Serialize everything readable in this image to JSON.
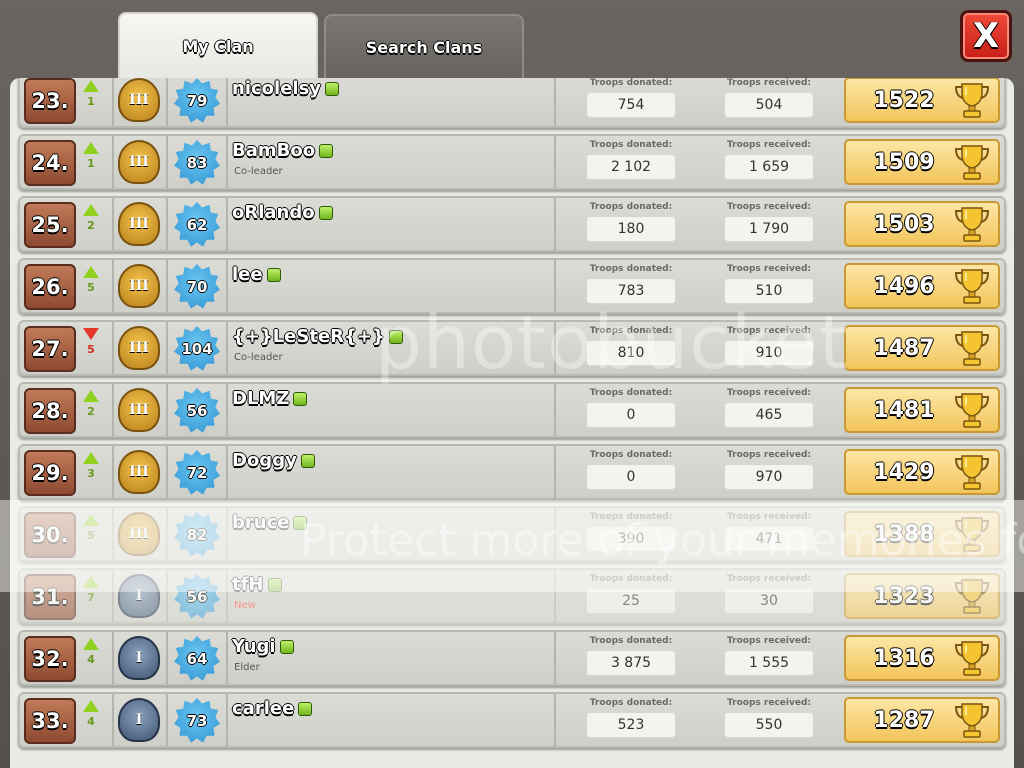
{
  "tabs": [
    {
      "label": "My Clan",
      "active": true
    },
    {
      "label": "Search Clans",
      "active": false
    }
  ],
  "close_label": "X",
  "stat_labels": {
    "donated": "Troops donated:",
    "received": "Troops received:"
  },
  "watermark": {
    "main": "photobucket",
    "sub": "Protect more of your memories for less!"
  },
  "members": [
    {
      "rank": "23.",
      "trend": "up",
      "delta": "1",
      "league": "gold",
      "league_label": "III",
      "level": "79",
      "name": "nicolelsy",
      "role": "",
      "donated": "754",
      "received": "504",
      "trophies": "1522"
    },
    {
      "rank": "24.",
      "trend": "up",
      "delta": "1",
      "league": "gold",
      "league_label": "III",
      "level": "83",
      "name": "BamBoo",
      "role": "Co-leader",
      "donated": "2 102",
      "received": "1 659",
      "trophies": "1509"
    },
    {
      "rank": "25.",
      "trend": "up",
      "delta": "2",
      "league": "gold",
      "league_label": "III",
      "level": "62",
      "name": "oRlando",
      "role": "",
      "donated": "180",
      "received": "1 790",
      "trophies": "1503"
    },
    {
      "rank": "26.",
      "trend": "up",
      "delta": "5",
      "league": "gold",
      "league_label": "III",
      "level": "70",
      "name": "lee",
      "role": "",
      "donated": "783",
      "received": "510",
      "trophies": "1496"
    },
    {
      "rank": "27.",
      "trend": "down",
      "delta": "5",
      "league": "gold",
      "league_label": "III",
      "level": "104",
      "name": "{+}LeSteR{+}",
      "role": "Co-leader",
      "donated": "810",
      "received": "910",
      "trophies": "1487"
    },
    {
      "rank": "28.",
      "trend": "up",
      "delta": "2",
      "league": "gold",
      "league_label": "III",
      "level": "56",
      "name": "DLMZ",
      "role": "",
      "donated": "0",
      "received": "465",
      "trophies": "1481"
    },
    {
      "rank": "29.",
      "trend": "up",
      "delta": "3",
      "league": "gold",
      "league_label": "III",
      "level": "72",
      "name": "Doggy",
      "role": "",
      "donated": "0",
      "received": "970",
      "trophies": "1429"
    },
    {
      "rank": "30.",
      "trend": "up",
      "delta": "5",
      "league": "gold",
      "league_label": "III",
      "level": "82",
      "name": "bruce",
      "role": "",
      "donated": "390",
      "received": "471",
      "trophies": "1388"
    },
    {
      "rank": "31.",
      "trend": "up",
      "delta": "7",
      "league": "silver",
      "league_label": "I",
      "level": "56",
      "name": "tfH",
      "role": "New",
      "donated": "25",
      "received": "30",
      "trophies": "1323"
    },
    {
      "rank": "32.",
      "trend": "up",
      "delta": "4",
      "league": "silver",
      "league_label": "I",
      "level": "64",
      "name": "Yugi",
      "role": "Elder",
      "donated": "3 875",
      "received": "1 555",
      "trophies": "1316"
    },
    {
      "rank": "33.",
      "trend": "up",
      "delta": "4",
      "league": "silver",
      "league_label": "I",
      "level": "73",
      "name": "carlee",
      "role": "",
      "donated": "523",
      "received": "550",
      "trophies": "1287"
    }
  ]
}
